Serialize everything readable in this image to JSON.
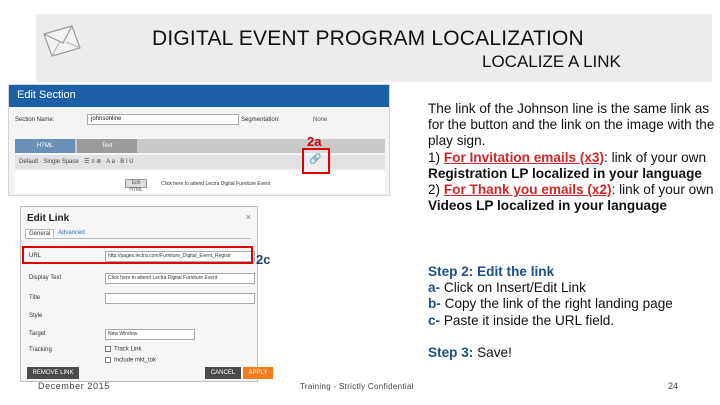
{
  "header": {
    "title": "DIGITAL EVENT PROGRAM LOCALIZATION",
    "subtitle": "LOCALIZE A LINK",
    "icon": "envelope-icon"
  },
  "edit_section": {
    "title": "Edit Section",
    "section_name_label": "Section Name:",
    "section_name_value": "johnsonline",
    "segmentation_label": "Segmentation:",
    "segmentation_value": "None",
    "tab_html": "HTML",
    "tab_text": "Text",
    "toolbar": "Default   ·   Single Space   ·   ☰  ≡  ≣   ·   A  a   ·   B  I  U",
    "button_label": "Edit HTML",
    "link_text": "Click here to attend Lectra Digital Furniture Event",
    "callout": "2a"
  },
  "edit_link": {
    "title": "Edit Link",
    "close": "×",
    "tab_general": "General",
    "tab_advanced": "Advanced",
    "url_label": "URL",
    "url_value": "http://pages.lectra.com/Furniture_Digital_Event_Registr",
    "display_label": "Display Text",
    "display_value": "Click here to attend Lectra Digital Furniture Event",
    "title_label": "Title",
    "style_label": "Style",
    "target_label": "Target",
    "target_value": "New Window",
    "tracking_label": "Tracking",
    "track_link": "Track Link",
    "include_token": "Include mkt_tok",
    "remove_button": "REMOVE LINK",
    "cancel_button": "CANCEL",
    "apply_button": "APPLY",
    "callout": "2c"
  },
  "body": {
    "intro": "The link of the Johnson line is the same link as for the button and the link on the image with the play sign.",
    "item1_prefix": "1) ",
    "item1_link": "For Invitation emails (x3)",
    "item1_mid": ": link of your own ",
    "item1_bold": "Registration LP localized in your language",
    "item2_prefix": "2) ",
    "item2_link": "For Thank you emails (x2)",
    "item2_mid": ": link of your own ",
    "item2_bold": "Videos LP localized in your language",
    "step2_head": "Step 2: ",
    "step2_title": "Edit the link",
    "step2_a_letter": "a-",
    "step2_a": " Click on Insert/Edit Link",
    "step2_b_letter": "b-",
    "step2_b": " Copy the link of the right landing page",
    "step2_c_letter": "c-",
    "step2_c": " Paste it inside the URL field.",
    "step3_head": "Step 3: ",
    "step3_text": "Save!"
  },
  "footer": {
    "date": "December 2015",
    "center": "Training - Strictly Confidential",
    "page": "24"
  },
  "colors": {
    "accent_blue": "#1e4f87",
    "callout_red": "#e00000",
    "apply_orange": "#f27c1e",
    "header_bg": "#ececec"
  }
}
